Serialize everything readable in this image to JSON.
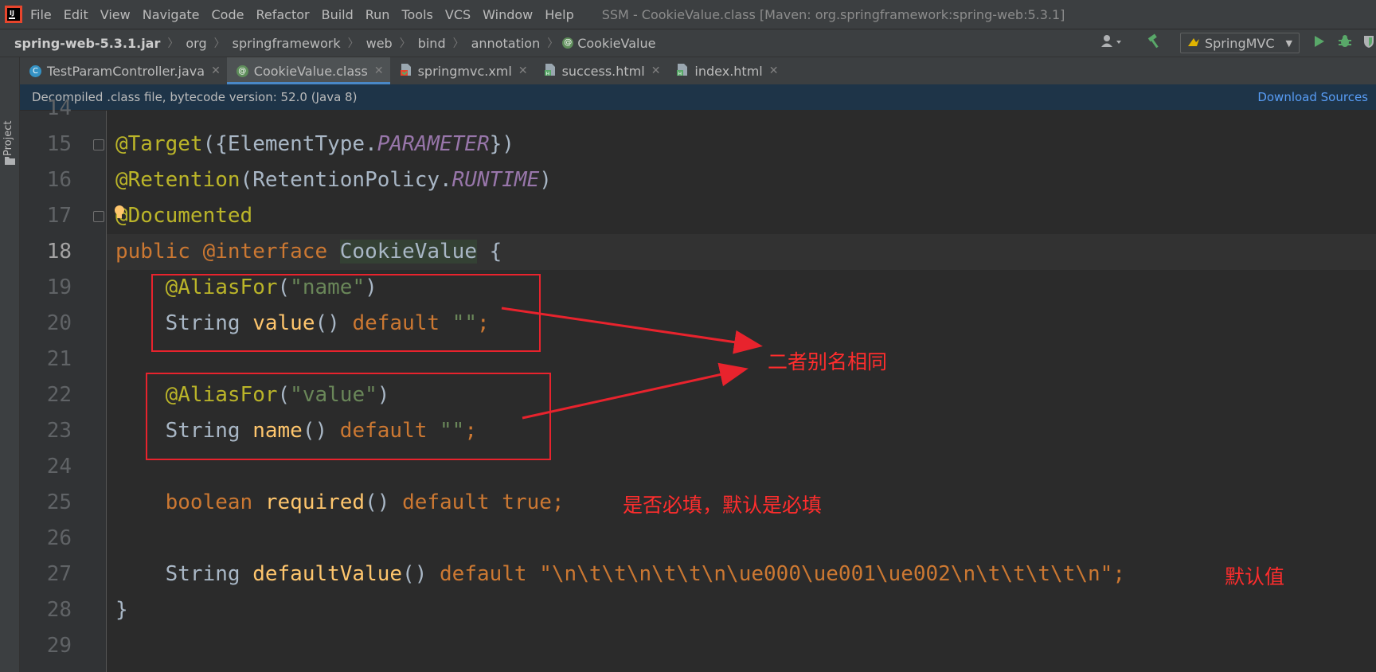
{
  "menubar": {
    "items": [
      "File",
      "Edit",
      "View",
      "Navigate",
      "Code",
      "Refactor",
      "Build",
      "Run",
      "Tools",
      "VCS",
      "Window",
      "Help"
    ],
    "window_title": "SSM - CookieValue.class [Maven: org.springframework:spring-web:5.3.1]"
  },
  "breadcrumb": {
    "items": [
      "spring-web-5.3.1.jar",
      "org",
      "springframework",
      "web",
      "bind",
      "annotation",
      "CookieValue"
    ]
  },
  "toolbar": {
    "run_config": "SpringMVC"
  },
  "sidebar": {
    "project_label": "Project"
  },
  "tabs": [
    {
      "label": "TestParamController.java",
      "icon": "java-class-icon",
      "active": false
    },
    {
      "label": "CookieValue.class",
      "icon": "annotation-icon",
      "active": true
    },
    {
      "label": "springmvc.xml",
      "icon": "xml-file-icon",
      "active": false
    },
    {
      "label": "success.html",
      "icon": "html-file-icon",
      "active": false
    },
    {
      "label": "index.html",
      "icon": "html-file-icon",
      "active": false
    }
  ],
  "infobar": {
    "message": "Decompiled .class file, bytecode version: 52.0 (Java 8)",
    "action": "Download Sources"
  },
  "editor": {
    "line_numbers": [
      "14",
      "15",
      "16",
      "17",
      "18",
      "19",
      "20",
      "21",
      "22",
      "23",
      "24",
      "25",
      "26",
      "27",
      "28",
      "29"
    ],
    "current_line": "18",
    "code": {
      "l15": {
        "at": "@Target",
        "open": "({ElementType.",
        "field": "PARAMETER",
        "close": "})"
      },
      "l16": {
        "at": "@Retention",
        "open": "(RetentionPolicy.",
        "field": "RUNTIME",
        "close": ")"
      },
      "l17": {
        "at": "@Documented"
      },
      "l18": {
        "kw1": "public",
        "kw2": "@interface",
        "name": "CookieValue",
        "brace": "{"
      },
      "l19": {
        "at": "@AliasFor",
        "open": "(",
        "str": "\"name\"",
        "close": ")"
      },
      "l20": {
        "type": "String",
        "method": "value",
        "parens": "()",
        "kw": "default",
        "str": "\"\"",
        "semi": ";"
      },
      "l22": {
        "at": "@AliasFor",
        "open": "(",
        "str": "\"value\"",
        "close": ")"
      },
      "l23": {
        "type": "String",
        "method": "name",
        "parens": "()",
        "kw": "default",
        "str": "\"\"",
        "semi": ";"
      },
      "l25": {
        "type": "boolean",
        "method": "required",
        "parens": "()",
        "kw": "default",
        "value": "true",
        "semi": ";"
      },
      "l27": {
        "type": "String",
        "method": "defaultValue",
        "parens": "()",
        "kw": "default",
        "str": "\"\\n\\t\\t\\n\\t\\t\\n\\ue000\\ue001\\ue002\\n\\t\\t\\t\\t\\n\"",
        "semi": ";"
      },
      "l28": {
        "brace": "}"
      }
    }
  },
  "annotations": {
    "alias_note": "二者别名相同",
    "required_note": "是否必填，默认是必填",
    "default_note": "默认值",
    "color": "#e8232d"
  },
  "colors": {
    "annotation": "#bbb529",
    "keyword": "#cc7832",
    "string": "#6a8759",
    "static_field": "#9876aa",
    "method": "#ffc66d",
    "text": "#a9b7c6",
    "link": "#589df6"
  }
}
